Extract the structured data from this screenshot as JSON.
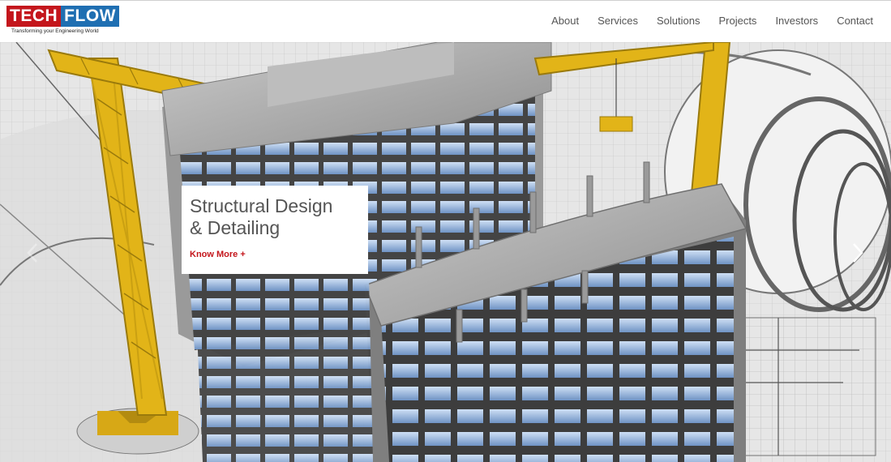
{
  "brand": {
    "logo_tech": "TECH",
    "logo_flow": "FLOW",
    "tagline": "Transforming your Engineering World"
  },
  "nav": {
    "items": [
      {
        "label": "About"
      },
      {
        "label": "Services"
      },
      {
        "label": "Solutions"
      },
      {
        "label": "Projects"
      },
      {
        "label": "Investors"
      },
      {
        "label": "Contact"
      }
    ]
  },
  "hero": {
    "title_line1": "Structural Design",
    "title_line2": "& Detailing",
    "cta_label": "Know More +",
    "prev_icon": "chevron-left-icon",
    "next_icon": "chevron-right-icon"
  },
  "colors": {
    "brand_red": "#c4161c",
    "brand_blue": "#1f6fb2",
    "crane_yellow": "#e2b418"
  }
}
